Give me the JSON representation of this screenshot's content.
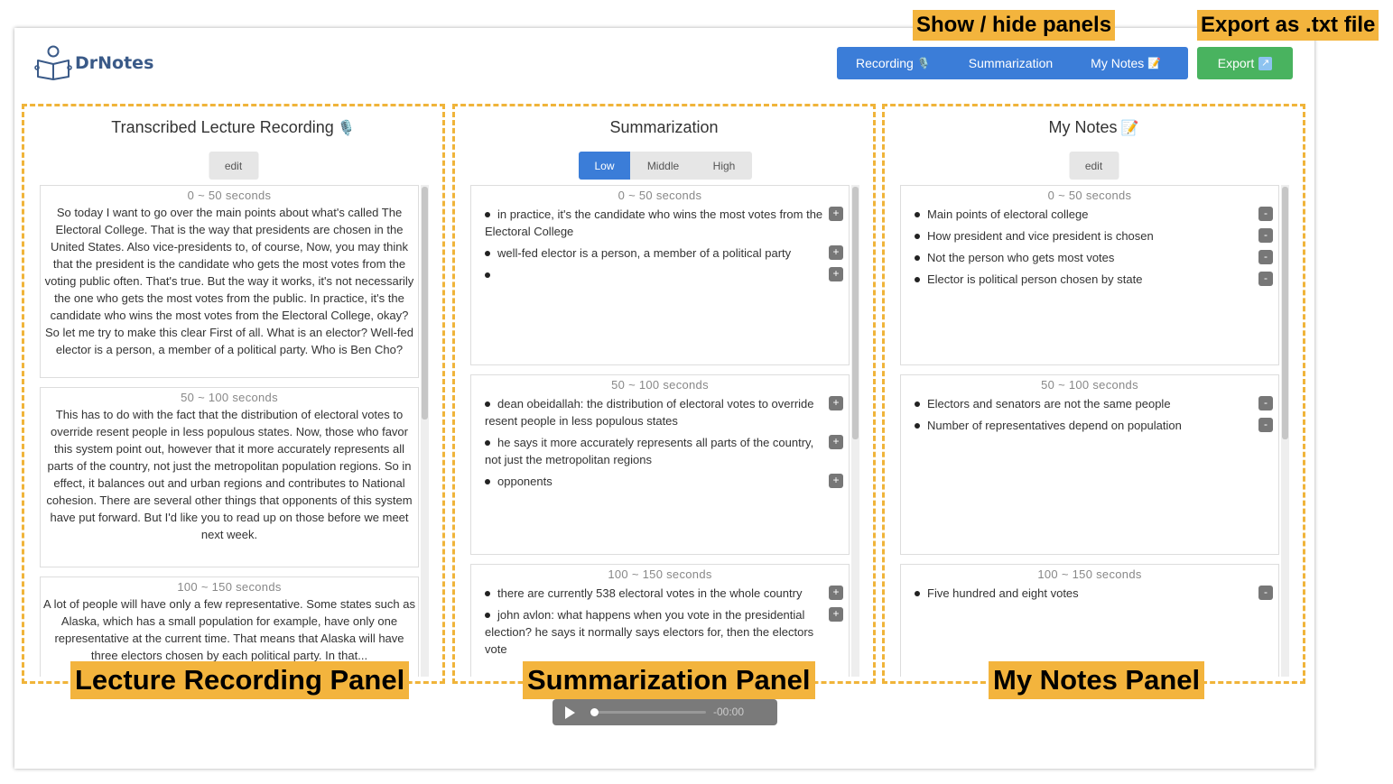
{
  "app": {
    "name": "DrNotes"
  },
  "nav": {
    "recording": "Recording",
    "recording_emoji": "🎙️",
    "summarization": "Summarization",
    "my_notes": "My Notes",
    "my_notes_emoji": "📝",
    "export": "Export",
    "export_icon": "↗"
  },
  "panels": {
    "recording": {
      "title": "Transcribed Lecture Recording",
      "title_emoji": "🎙️",
      "edit_label": "edit",
      "chunks": [
        {
          "time": "0 ~ 50 seconds",
          "text": "So today I want to go over the main points about what's called The Electoral College. That is the way that presidents are chosen in the United States. Also vice-presidents to, of course, Now, you may think that the president is the candidate who gets the most votes from the voting public often. That's true. But the way it works, it's not necessarily the one who gets the most votes from the public. In practice, it's the candidate who wins the most votes from the Electoral College, okay? So let me try to make this clear First of all. What is an elector? Well-fed elector is a person, a member of a political party. Who is Ben Cho?"
        },
        {
          "time": "50 ~ 100 seconds",
          "text": "This has to do with the fact that the distribution of electoral votes to override resent people in less populous states. Now, those who favor this system point out, however that it more accurately represents all parts of the country, not just the metropolitan population regions. So in effect, it balances out and urban regions and contributes to National cohesion. There are several other things that opponents of this system have put forward. But I'd like you to read up on those before we meet next week."
        },
        {
          "time": "100 ~ 150 seconds",
          "text": "A lot of people will have only a few representative. Some states such as Alaska, which has a small population for example, have only one representative at the current time. That means that Alaska will have three electors chosen by each political party. In that..."
        }
      ]
    },
    "summarization": {
      "title": "Summarization",
      "levels": [
        "Low",
        "Middle",
        "High"
      ],
      "active_level": "Low",
      "chunks": [
        {
          "time": "0 ~ 50 seconds",
          "items": [
            "in practice, it's the candidate who wins the most votes from the Electoral College",
            "well-fed elector is a person, a member of a political party",
            ""
          ]
        },
        {
          "time": "50 ~ 100 seconds",
          "items": [
            "dean obeidallah: the distribution of electoral votes to override resent people in less populous states",
            "he says it more accurately represents all parts of the country, not just the metropolitan regions",
            "opponents"
          ]
        },
        {
          "time": "100 ~ 150 seconds",
          "items": [
            "there are currently 538 electoral votes in the whole country",
            "john avlon: what happens when you vote in the presidential election? he says it normally says electors for, then the electors vote"
          ]
        }
      ],
      "add_symbol": "+"
    },
    "notes": {
      "title": "My Notes",
      "title_emoji": "📝",
      "edit_label": "edit",
      "chunks": [
        {
          "time": "0 ~ 50 seconds",
          "items": [
            "Main points of electoral college",
            "How president and vice president is chosen",
            "Not the person who gets most votes",
            "Elector is political person chosen by state"
          ]
        },
        {
          "time": "50 ~ 100 seconds",
          "items": [
            "Electors and senators are not the same people",
            "Number of representatives depend on population"
          ]
        },
        {
          "time": "100 ~ 150 seconds",
          "items": [
            "Five hundred and eight votes"
          ]
        }
      ],
      "remove_symbol": "-"
    }
  },
  "player": {
    "time": "-00:00",
    "progress": 0
  },
  "callouts": {
    "show_hide": "Show / hide panels",
    "export": "Export as .txt file",
    "recording_panel": "Lecture Recording Panel",
    "summarization_panel": "Summarization Panel",
    "notes_panel": "My Notes Panel"
  },
  "colors": {
    "primary": "#3b7dd8",
    "export": "#49b35f",
    "callout": "#f3b43d",
    "panel_border": "#f0b43a"
  }
}
